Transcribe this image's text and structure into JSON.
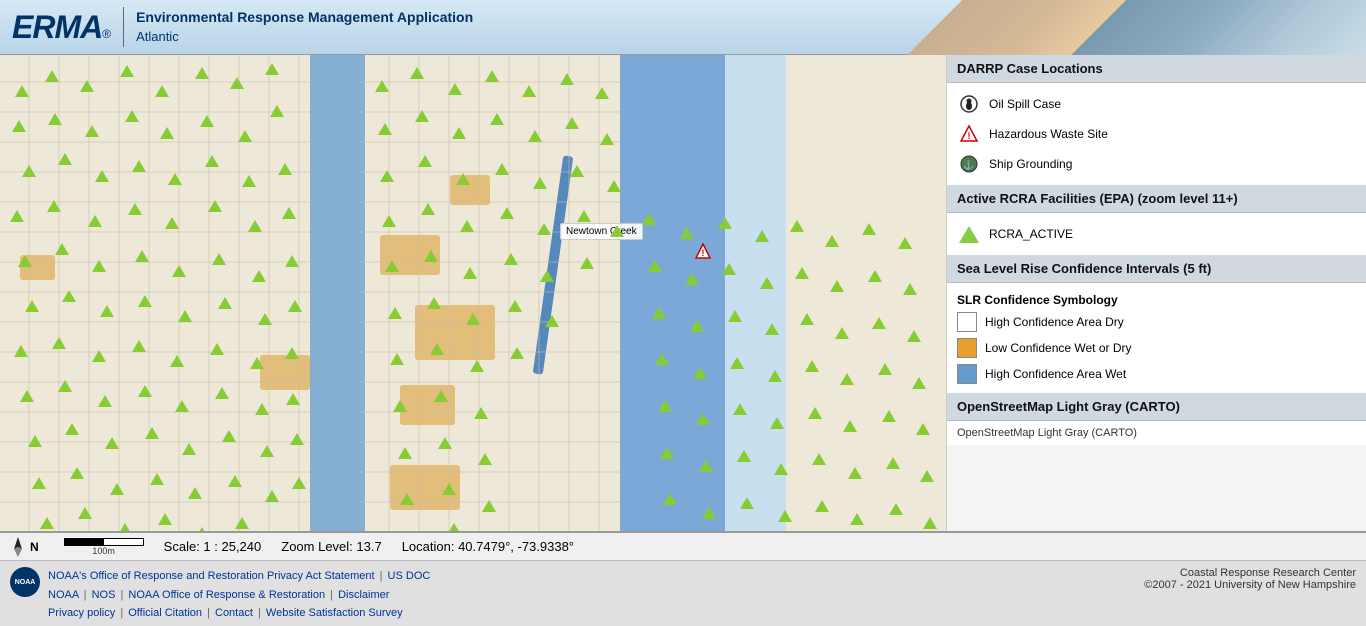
{
  "header": {
    "logo": "ERMA",
    "reg_mark": "®",
    "app_title_line1": "Environmental Response Management Application",
    "app_title_line2": "Atlantic"
  },
  "legend": {
    "darrp_title": "DARRP Case Locations",
    "darrp_items": [
      {
        "label": "Oil Spill Case",
        "icon": "oil-spill"
      },
      {
        "label": "Hazardous Waste Site",
        "icon": "hazard"
      },
      {
        "label": "Ship Grounding",
        "icon": "ship"
      }
    ],
    "rcra_title": "Active RCRA Facilities (EPA) (zoom level 11+)",
    "rcra_items": [
      {
        "label": "RCRA_ACTIVE",
        "icon": "triangle"
      }
    ],
    "slr_title": "Sea Level Rise Confidence Intervals (5 ft)",
    "slr_subsection": "SLR Confidence Symbology",
    "slr_items": [
      {
        "label": "High Confidence Area Dry",
        "color": "#ffffff"
      },
      {
        "label": "Low Confidence Wet or Dry",
        "color": "#e8a030"
      },
      {
        "label": "High Confidence Area Wet",
        "color": "#6699cc"
      }
    ],
    "osm_title": "OpenStreetMap Light Gray (CARTO)",
    "osm_subtitle": "OpenStreetMap Light Gray (CARTO)"
  },
  "map": {
    "label_newtown_creek": "Newtown Creek",
    "location_label": "Location: 40.7479°, -73.9338°",
    "scale_label": "Scale: 1 : 25,240",
    "zoom_label": "Zoom Level: 13.7"
  },
  "footer": {
    "links_line1": [
      {
        "text": "NOAA's Office of Response and Restoration Privacy Act Statement",
        "sep": "|"
      },
      {
        "text": "US DOC"
      }
    ],
    "links_line2": [
      {
        "text": "NOAA",
        "sep": "|"
      },
      {
        "text": "NOS",
        "sep": "|"
      },
      {
        "text": "NOAA Office of Response & Restoration",
        "sep": "|"
      },
      {
        "text": "Disclaimer"
      }
    ],
    "links_line3": [
      {
        "text": "Privacy policy",
        "sep": "|"
      },
      {
        "text": "Official Citation",
        "sep": "|"
      },
      {
        "text": "Contact",
        "sep": "|"
      },
      {
        "text": "Website Satisfaction Survey"
      }
    ],
    "right_credit_line1": "Coastal Response Research Center",
    "right_credit_line2": "©2007 - 2021 University of New Hampshire"
  }
}
